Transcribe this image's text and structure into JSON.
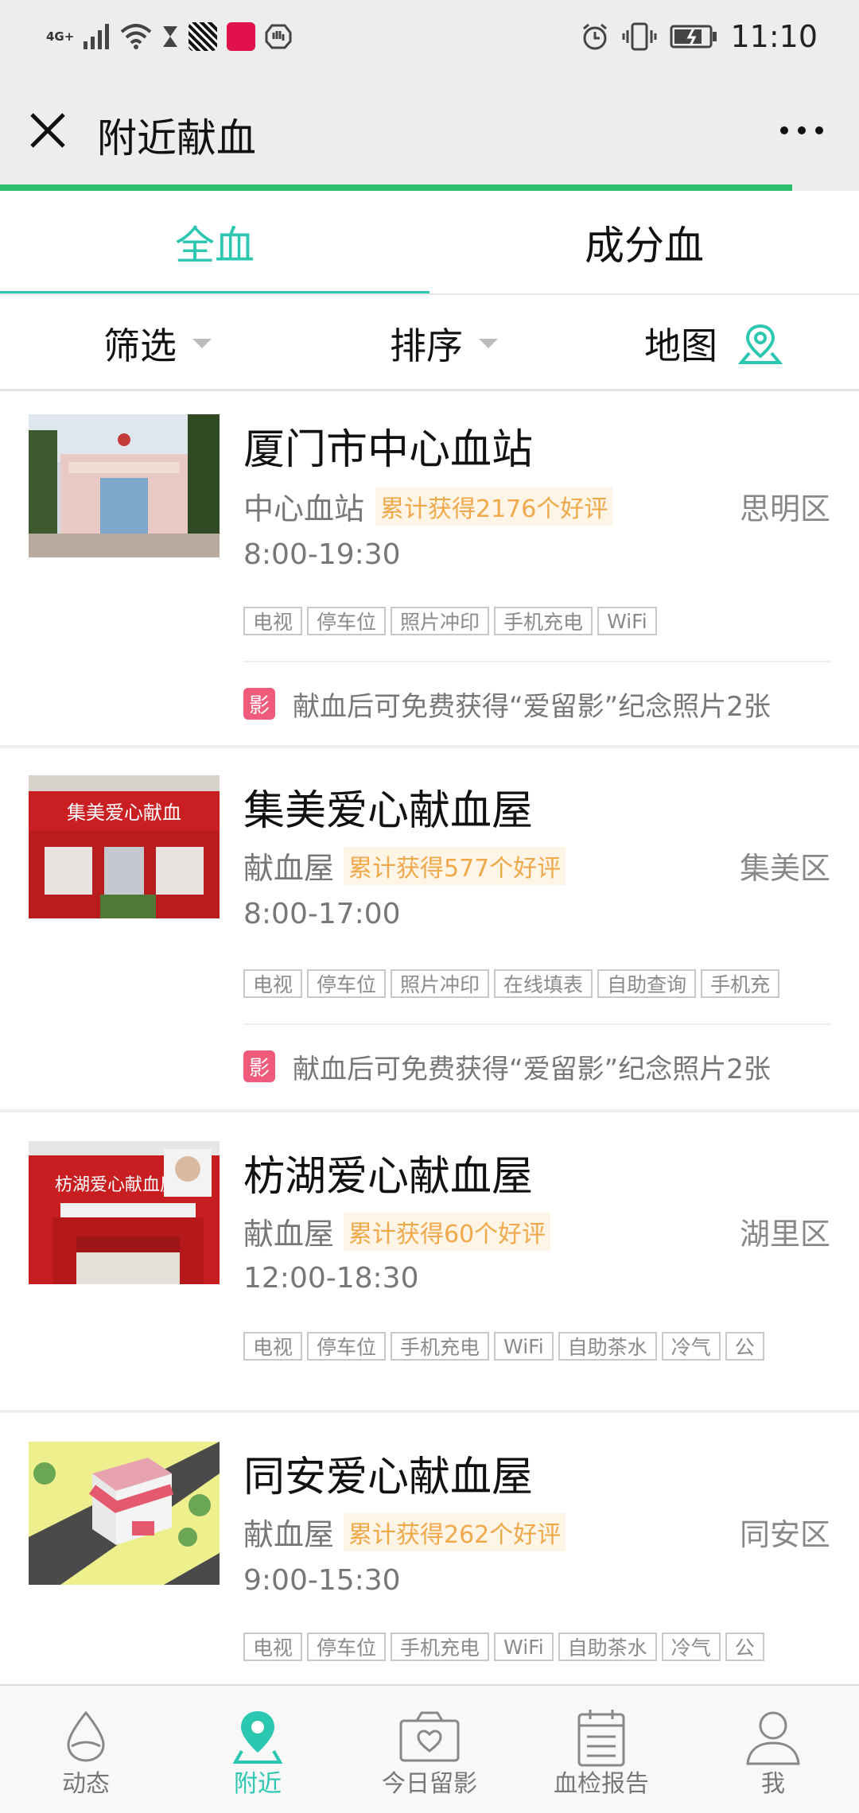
{
  "status_bar": {
    "time": "11:10",
    "network": "4G+",
    "icons": [
      "signal-icon",
      "wifi-icon",
      "hourglass-icon",
      "app-icon",
      "tmall-icon",
      "shield-icon",
      "alarm-icon",
      "vibrate-icon",
      "battery-icon"
    ]
  },
  "nav": {
    "title": "附近献血",
    "close_icon": "close-icon",
    "more_icon": "more-icon"
  },
  "tabs": [
    {
      "label": "全血",
      "active": true
    },
    {
      "label": "成分血",
      "active": false
    }
  ],
  "filters": {
    "filter_label": "筛选",
    "sort_label": "排序",
    "map_label": "地图"
  },
  "stations": [
    {
      "name": "厦门市中心血站",
      "type": "中心血站",
      "reviews": "累计获得2176个好评",
      "district": "思明区",
      "hours": "8:00-19:30",
      "tags": [
        "电视",
        "停车位",
        "照片冲印",
        "手机充电",
        "WiFi"
      ],
      "promo": "献血后可免费获得“爱留影”纪念照片2张"
    },
    {
      "name": "集美爱心献血屋",
      "type": "献血屋",
      "reviews": "累计获得577个好评",
      "district": "集美区",
      "hours": "8:00-17:00",
      "tags": [
        "电视",
        "停车位",
        "照片冲印",
        "在线填表",
        "自助查询",
        "手机充"
      ],
      "promo": "献血后可免费获得“爱留影”纪念照片2张"
    },
    {
      "name": "枋湖爱心献血屋",
      "type": "献血屋",
      "reviews": "累计获得60个好评",
      "district": "湖里区",
      "hours": "12:00-18:30",
      "tags": [
        "电视",
        "停车位",
        "手机充电",
        "WiFi",
        "自助茶水",
        "冷气",
        "公"
      ]
    },
    {
      "name": "同安爱心献血屋",
      "type": "献血屋",
      "reviews": "累计获得262个好评",
      "district": "同安区",
      "hours": "9:00-15:30",
      "tags": [
        "电视",
        "停车位",
        "手机充电",
        "WiFi",
        "自助茶水",
        "冷气",
        "公"
      ]
    }
  ],
  "promo_icon_text": "影",
  "bottom_tabs": [
    {
      "label": "动态",
      "icon": "drop-icon",
      "active": false
    },
    {
      "label": "附近",
      "icon": "location-icon",
      "active": true
    },
    {
      "label": "今日留影",
      "icon": "camera-icon",
      "active": false
    },
    {
      "label": "血检报告",
      "icon": "report-icon",
      "active": false
    },
    {
      "label": "我",
      "icon": "person-icon",
      "active": false
    }
  ],
  "colors": {
    "accent": "#2cc7b0",
    "progress": "#2dbe6c",
    "badge_text": "#efa84a",
    "badge_bg": "#fff5e6",
    "promo_icon": "#f05b7c"
  }
}
